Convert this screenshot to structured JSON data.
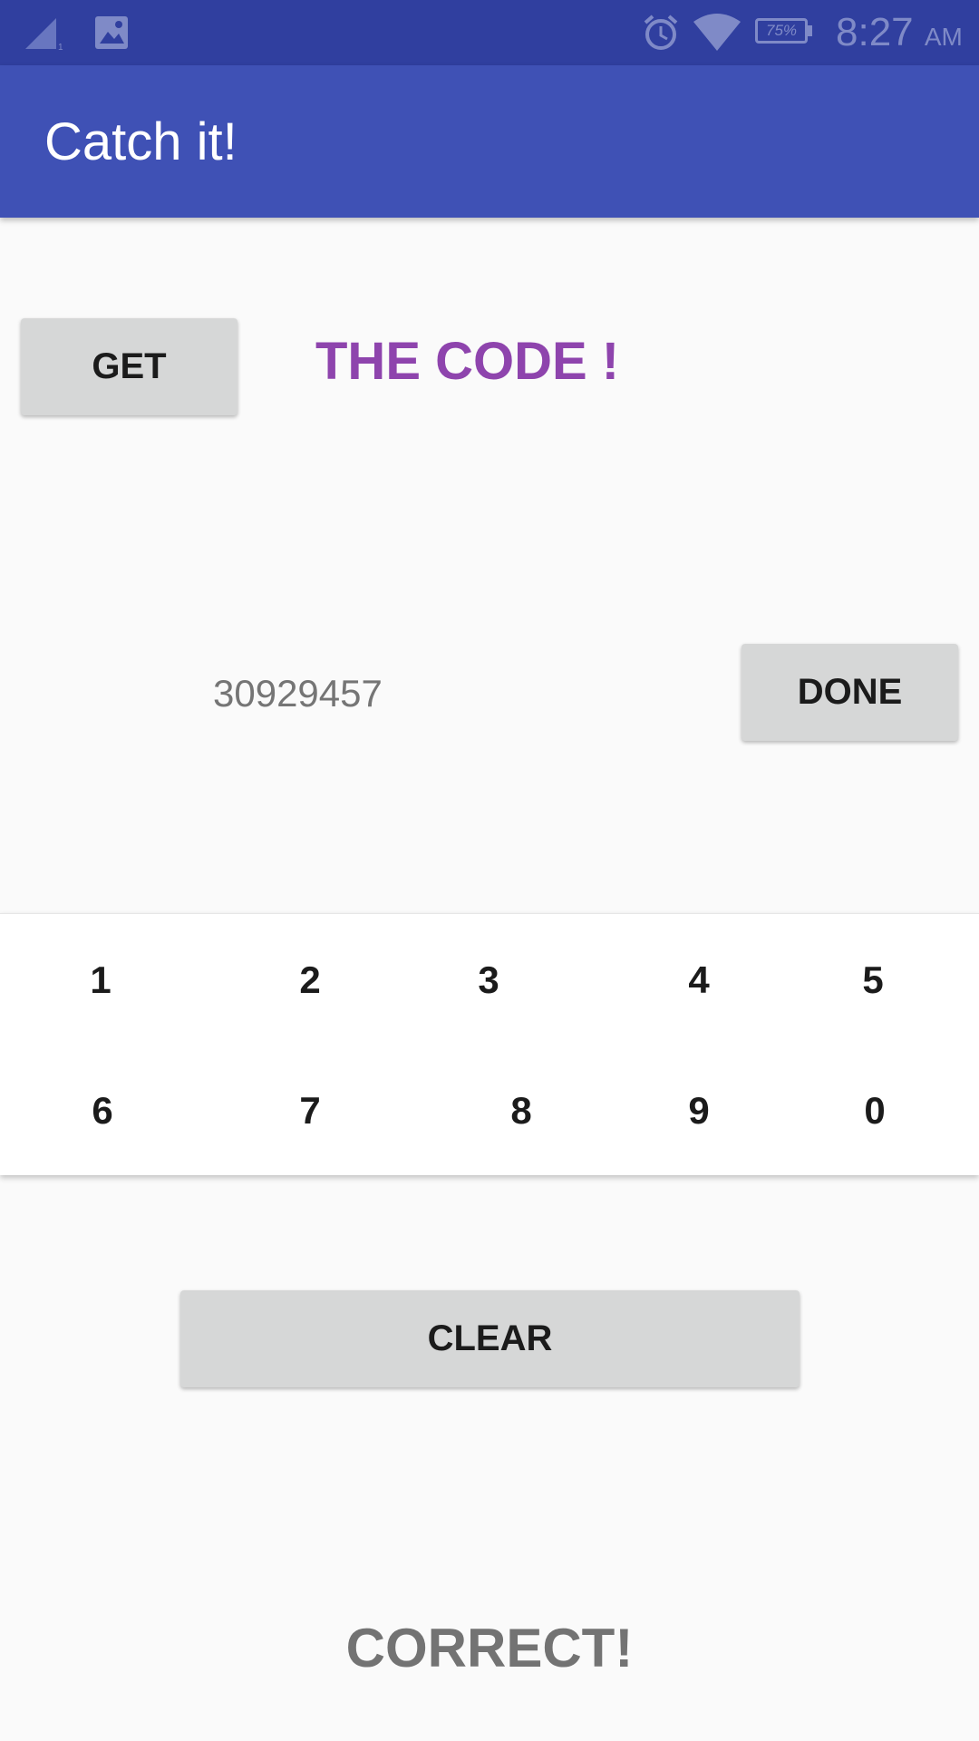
{
  "status_bar": {
    "battery": "75%",
    "time": "8:27",
    "ampm": "AM",
    "icons": [
      "signal-icon",
      "image-notification-icon",
      "alarm-icon",
      "wifi-icon",
      "battery-icon"
    ]
  },
  "app_bar": {
    "title": "Catch it!"
  },
  "main": {
    "get_button": "GET",
    "headline": "THE CODE !",
    "code_value": "30929457",
    "done_button": "DONE",
    "clear_button": "CLEAR",
    "result": "CORRECT!"
  },
  "keypad": {
    "keys": [
      "1",
      "2",
      "3",
      "4",
      "5",
      "6",
      "7",
      "8",
      "9",
      "0"
    ]
  },
  "colors": {
    "status_bar": "#303f9f",
    "app_bar": "#3f51b5",
    "headline": "#8e44ad",
    "button": "#d6d7d7"
  }
}
